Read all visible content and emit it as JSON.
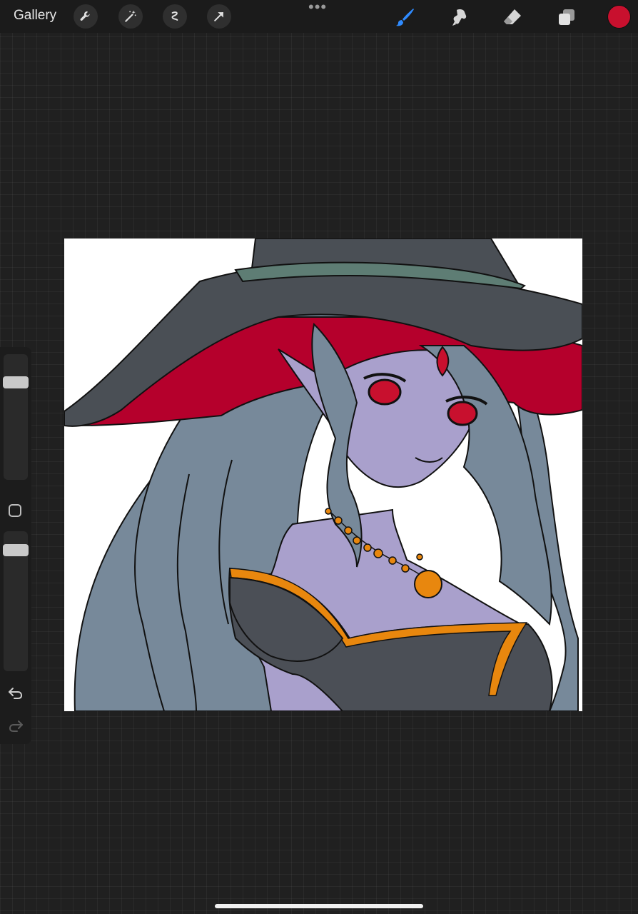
{
  "topbar": {
    "gallery_label": "Gallery",
    "left_tools": [
      {
        "name": "wrench-icon"
      },
      {
        "name": "magic-wand-icon"
      },
      {
        "name": "selection-icon"
      },
      {
        "name": "transform-arrow-icon"
      }
    ],
    "more_dots": "•••",
    "right_tools": [
      {
        "name": "brush-icon",
        "active": true,
        "color": "#2f8bff"
      },
      {
        "name": "smudge-icon",
        "active": false
      },
      {
        "name": "eraser-icon",
        "active": false
      },
      {
        "name": "layers-icon",
        "active": false
      }
    ],
    "current_color": "#c8102e"
  },
  "sidebar": {
    "brush_size_fraction": 0.06,
    "opacity_fraction": 0.05,
    "modify_icon": "square-modify-icon",
    "undo_icon": "undo-icon",
    "redo_icon": "redo-icon"
  },
  "canvas": {
    "artwork": "witch-character-illustration",
    "palette": {
      "hat": "#4a4f55",
      "hat_band": "#5e7d74",
      "hat_inner": "#b5002c",
      "hair": "#77899a",
      "skin": "#a9a0cc",
      "eyes": "#c8102e",
      "dress": "#4b4f56",
      "trim": "#e8870e",
      "outline": "#111111"
    }
  }
}
